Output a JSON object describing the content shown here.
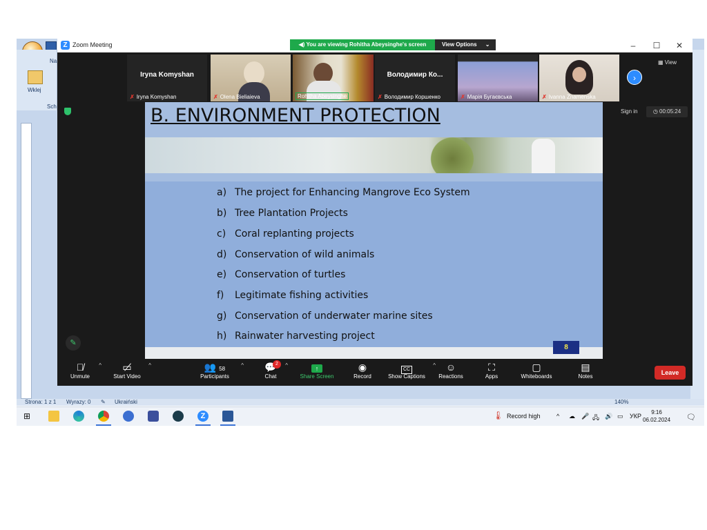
{
  "word": {
    "ribbon_tab": "Na",
    "paste_label": "Wklej",
    "clipboard_label": "Sch",
    "status": {
      "page": "Strona: 1 z 1",
      "words": "Wyrazy: 0",
      "language": "Ukraiński",
      "zoom": "140%"
    }
  },
  "zoom": {
    "window_title": "Zoom Meeting",
    "viewing_banner": "You are viewing Rohitha Abeysinghe's screen",
    "view_options": "View Options",
    "view_button": "View",
    "sign_in": "Sign in",
    "timer": "00:05:24",
    "participants": [
      {
        "display": "Iryna Komyshan",
        "caption": "Iryna Komyshan"
      },
      {
        "display": "",
        "caption": "Olena Bieliaieva"
      },
      {
        "display": "",
        "caption": "Rohitha Abeysinghe"
      },
      {
        "display": "Володимир Ко...",
        "caption": "Володимир Коршенко"
      },
      {
        "display": "",
        "caption": "Марія Бугаєвська"
      },
      {
        "display": "",
        "caption": "Ivanna Znamenska"
      }
    ],
    "toolbar": {
      "unmute": "Unmute",
      "start_video": "Start Video",
      "participants_label": "Participants",
      "participants_count": "58",
      "chat": "Chat",
      "chat_badge": "2",
      "share_screen": "Share Screen",
      "record": "Record",
      "show_captions": "Show Captions",
      "reactions": "Reactions",
      "apps": "Apps",
      "whiteboards": "Whiteboards",
      "notes": "Notes",
      "leave": "Leave",
      "accent_green": "#1ea94b",
      "leave_color": "#d22a26"
    }
  },
  "slide": {
    "title": "B. ENVIRONMENT PROTECTION",
    "items": [
      {
        "letter": "a)",
        "text": "The project for Enhancing Mangrove Eco System"
      },
      {
        "letter": "b)",
        "text": "Tree Plantation Projects"
      },
      {
        "letter": "c)",
        "text": "Coral replanting projects"
      },
      {
        "letter": "d)",
        "text": "Conservation of wild animals"
      },
      {
        "letter": "e)",
        "text": "Conservation of turtles"
      },
      {
        "letter": "f)",
        "text": "Legitimate fishing activities"
      },
      {
        "letter": "g)",
        "text": "Conservation of underwater marine sites"
      },
      {
        "letter": "h)",
        "text": "Rainwater harvesting project"
      }
    ],
    "page_number": "8"
  },
  "taskbar": {
    "record_high": "Record high",
    "language": "УКР",
    "time": "9:16",
    "date": "06.02.2024"
  }
}
